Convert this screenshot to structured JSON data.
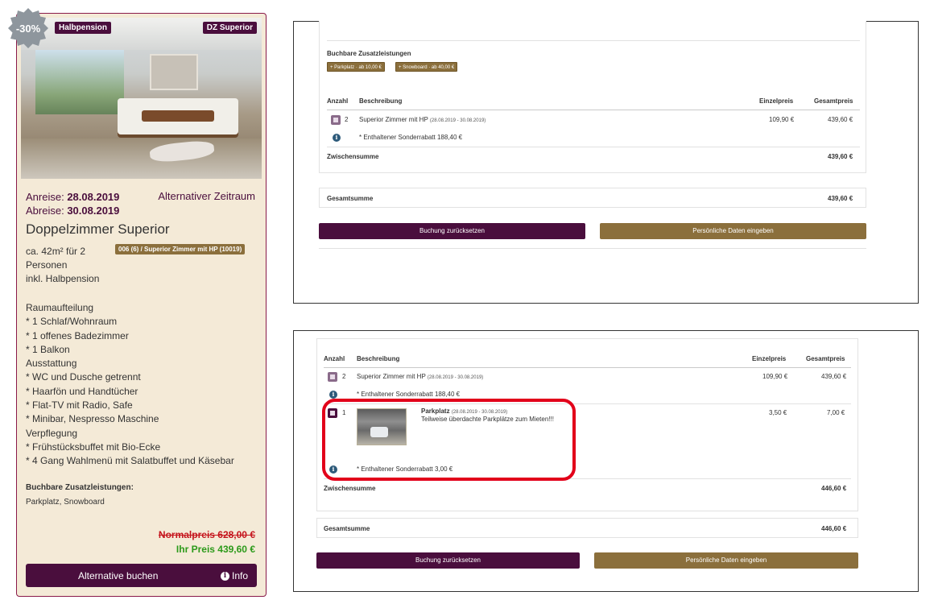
{
  "card": {
    "discount": "-30%",
    "badge_board": "Halbpension",
    "badge_room": "DZ Superior",
    "arrival_label": "Anreise:",
    "arrival_date": "28.08.2019",
    "departure_label": "Abreise:",
    "departure_date": "30.08.2019",
    "alt_period": "Alternativer Zeitraum",
    "room_title": "Doppelzimmer Superior",
    "size_line1": "ca. 42m² für 2",
    "size_line2": "Personen",
    "size_line3": "inkl. Halbpension",
    "code": "006 (6) / Superior Zimmer mit HP (10019)",
    "features": [
      "Raumaufteilung",
      "* 1 Schlaf/Wohnraum",
      "* 1 offenes Badezimmer",
      "* 1 Balkon",
      "Ausstattung",
      "* WC und Dusche getrennt",
      "* Haarfön und Handtücher",
      "* Flat-TV mit Radio, Safe",
      "* Minibar, Nespresso Maschine",
      "Verpflegung",
      "* Frühstücksbuffet mit Bio-Ecke",
      "* 4 Gang Wahlmenü mit Salatbuffet und Käsebar"
    ],
    "extras_title": "Buchbare Zusatzleistungen:",
    "extras_text": "Parkplatz, Snowboard",
    "normal_price": "Normalpreis 628,00 €",
    "your_price": "Ihr Preis 439,60 €",
    "book_button": "Alternative buchen",
    "info_button": "Info",
    "colors": {
      "primary": "#4a0e3d",
      "gold": "#8b6f3c",
      "strike": "#c5141c",
      "green": "#2c9a1a",
      "card_bg": "#f4ead7"
    }
  },
  "panel1": {
    "extras_heading": "Buchbare Zusatzleistungen",
    "chip_parking": "+ Parkplatz · ab 10,00 €",
    "chip_snowboard": "+ Snowboard · ab 40,00 €",
    "col_qty": "Anzahl",
    "col_desc": "Beschreibung",
    "col_unit": "Einzelpreis",
    "col_total": "Gesamtpreis",
    "row1_qty": "2",
    "row1_desc": "Superior Zimmer mit HP",
    "row1_dates": "(28.08.2019 - 30.08.2019)",
    "row1_unit": "109,90 €",
    "row1_total": "439,60 €",
    "row1_discount": "* Enthaltener Sonderrabatt 188,40 €",
    "subtotal_label": "Zwischensumme",
    "subtotal_value": "439,60 €",
    "total_label": "Gesamtsumme",
    "total_value": "439,60 €",
    "reset_button": "Buchung zurücksetzen",
    "personal_button": "Persönliche Daten eingeben"
  },
  "panel2": {
    "col_qty": "Anzahl",
    "col_desc": "Beschreibung",
    "col_unit": "Einzelpreis",
    "col_total": "Gesamtpreis",
    "row1_qty": "2",
    "row1_desc": "Superior Zimmer mit HP",
    "row1_dates": "(28.08.2019 - 30.08.2019)",
    "row1_unit": "109,90 €",
    "row1_total": "439,60 €",
    "row1_discount": "* Enthaltener Sonderrabatt 188,40 €",
    "row2_qty": "1",
    "row2_title": "Parkplatz",
    "row2_dates": "(28.08.2019 - 30.08.2019)",
    "row2_desc": "Teilweise überdachte Parkplätze zum Mieten!!!",
    "row2_unit": "3,50 €",
    "row2_total": "7,00 €",
    "row2_discount": "* Enthaltener Sonderrabatt 3,00 €",
    "subtotal_label": "Zwischensumme",
    "subtotal_value": "446,60 €",
    "total_label": "Gesamtsumme",
    "total_value": "446,60 €",
    "reset_button": "Buchung zurücksetzen",
    "personal_button": "Persönliche Daten eingeben"
  }
}
